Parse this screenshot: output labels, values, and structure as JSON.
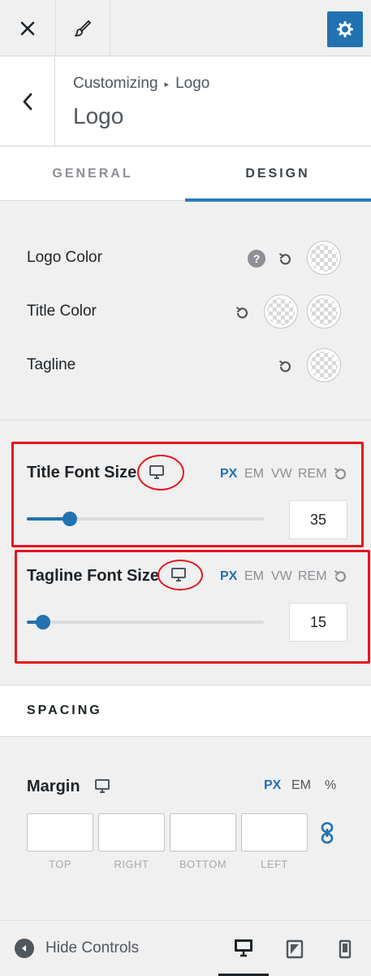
{
  "topbar": {
    "close_icon": "close-icon",
    "brush_icon": "brush-icon",
    "settings_icon": "gear-icon"
  },
  "breadcrumb": {
    "parent": "Customizing",
    "current": "Logo",
    "title": "Logo"
  },
  "tabs": [
    {
      "label": "GENERAL",
      "active": false
    },
    {
      "label": "DESIGN",
      "active": true
    }
  ],
  "colors": [
    {
      "label": "Logo Color",
      "swatches": 1,
      "has_help": true,
      "help_symbol": "?"
    },
    {
      "label": "Title Color",
      "swatches": 2,
      "has_help": false
    },
    {
      "label": "Tagline",
      "swatches": 1,
      "has_help": false
    }
  ],
  "title_font_size": {
    "label": "Title Font Size",
    "units": [
      "PX",
      "EM",
      "VW",
      "REM"
    ],
    "active_unit": "PX",
    "value": "35",
    "slider_fraction": 0.18
  },
  "tagline_font_size": {
    "label": "Tagline Font Size",
    "units": [
      "PX",
      "EM",
      "VW",
      "REM"
    ],
    "active_unit": "PX",
    "value": "15",
    "slider_fraction": 0.07
  },
  "spacing": {
    "heading": "SPACING",
    "margin_label": "Margin",
    "units": [
      "PX",
      "EM",
      "%"
    ],
    "active_unit": "PX",
    "fields": [
      {
        "label": "TOP",
        "value": ""
      },
      {
        "label": "RIGHT",
        "value": ""
      },
      {
        "label": "BOTTOM",
        "value": ""
      },
      {
        "label": "LEFT",
        "value": ""
      }
    ]
  },
  "footer": {
    "hide_controls_label": "Hide Controls",
    "devices": [
      "desktop-icon",
      "tablet-icon",
      "mobile-icon"
    ],
    "active_device": "desktop"
  },
  "accent_color": "#2271b1",
  "highlight_color": "#e8141c"
}
